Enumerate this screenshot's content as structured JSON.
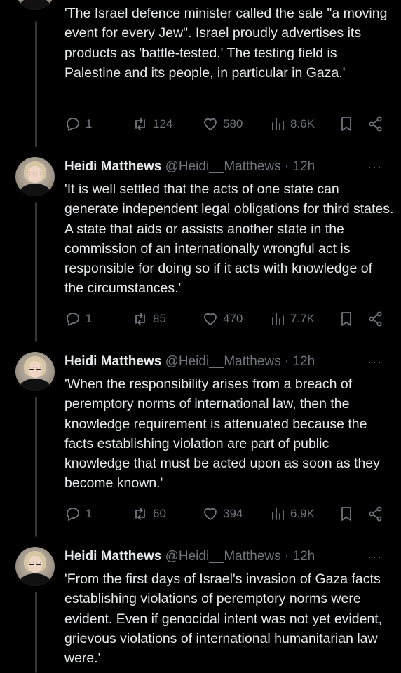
{
  "tweets": [
    {
      "text": "'The Israel defence minister called the sale \"a moving event for every Jew\". Israel proudly advertises its products as 'battle-tested.' The testing field is Palestine and its people, in particular in Gaza.'",
      "replies": "1",
      "retweets": "124",
      "likes": "580",
      "views": "8.6K"
    },
    {
      "name": "Heidi Matthews",
      "handle": "@Heidi__Matthews",
      "time": "· 12h",
      "more": "···",
      "text": "'It is well settled that the acts of one state can generate independent legal obligations for third states. A state that aids or assists another state in the commission of an internationally wrongful act is responsible for doing so if it acts with knowledge of the circumstances.'",
      "replies": "1",
      "retweets": "85",
      "likes": "470",
      "views": "7.7K"
    },
    {
      "name": "Heidi Matthews",
      "handle": "@Heidi__Matthews",
      "time": "· 12h",
      "more": "···",
      "text": "'When the responsibility arises from a breach of peremptory norms of international law, then the knowledge requirement is attenuated because the facts establishing violation are part of public knowledge that must be acted upon as soon as they become known.'",
      "replies": "1",
      "retweets": "60",
      "likes": "394",
      "views": "6.9K"
    },
    {
      "name": "Heidi Matthews",
      "handle": "@Heidi__Matthews",
      "time": "· 12h",
      "more": "···",
      "text": "'From the first days of Israel's invasion of Gaza facts establishing violations of peremptory norms were evident. Even if genocidal intent was not yet evident, grievous violations of international humanitarian law were.'"
    }
  ],
  "icons": {
    "reply": "reply-icon",
    "retweet": "retweet-icon",
    "like": "heart-icon",
    "views": "views-icon",
    "bookmark": "bookmark-icon",
    "share": "share-icon"
  },
  "colors": {
    "background": "#000000",
    "text": "#e7e9ea",
    "secondary": "#71767b",
    "thread_line": "#333639"
  }
}
